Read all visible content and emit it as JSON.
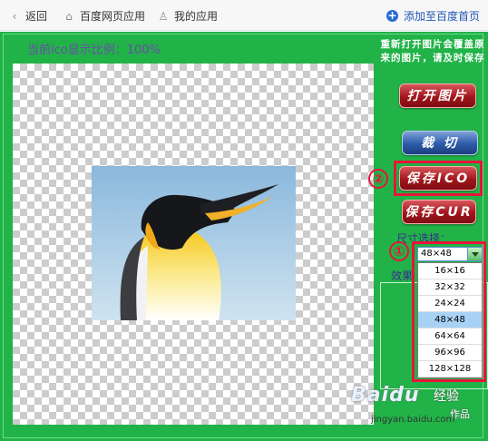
{
  "topbar": {
    "back_label": "返回",
    "home_label": "百度网页应用",
    "mine_label": "我的应用",
    "add_label": "添加至百度首页"
  },
  "editor": {
    "zoom_text": "当前ico显示比例：100%",
    "notice": "重新打开图片会覆盖原来的图片，请及时保存",
    "buttons": {
      "open": "打开图片",
      "cut": "裁 切",
      "save_ico": "保存ICO",
      "save_cur": "保存CUR"
    },
    "size_label": "尺寸选择：",
    "effect_label": "效果",
    "size_selected": "48×48",
    "size_options": [
      "16×16",
      "32×32",
      "24×24",
      "48×48",
      "64×64",
      "96×96",
      "128×128"
    ],
    "step_markers": [
      "①",
      "②"
    ]
  },
  "watermark": {
    "logo": "Baidu",
    "cn": "经验",
    "url": "jingyan.baidu.com",
    "sub": "作品"
  },
  "colors": {
    "workspace_bg": "#21b348",
    "highlight": "#e8143a",
    "button_red": "#a1161c",
    "button_blue": "#2d5ba8"
  }
}
